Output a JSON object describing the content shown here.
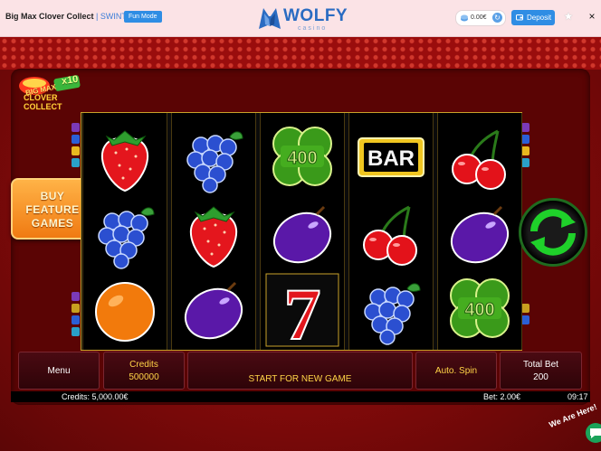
{
  "header": {
    "game_title": "Big Max Clover Collect",
    "separator": " | ",
    "provider": "SWINTT",
    "fun_mode": "Fun Mode",
    "logo_text": "WOLFY",
    "logo_sub": "casino",
    "balance": "0.00€",
    "deposit_label": "Deposit",
    "star_glyph": "★",
    "close_glyph": "×"
  },
  "game": {
    "brand_line1": "BIG MAX",
    "brand_line2": "CLOVER",
    "brand_line3": "COLLECT",
    "brand_multiplier": "x10",
    "buy_line1": "BUY",
    "buy_line2": "FEATURE",
    "buy_line3": "GAMES",
    "reels": [
      [
        "strawberry",
        "grapes",
        "orange"
      ],
      [
        "grapes",
        "strawberry",
        "plum"
      ],
      [
        "clover-400",
        "plum",
        "seven"
      ],
      [
        "bar",
        "cherry",
        "grapes"
      ],
      [
        "cherry",
        "plum",
        "clover-400"
      ]
    ],
    "clover_value": "400",
    "bar_label": "BAR",
    "seven_label": "7"
  },
  "controls": {
    "menu": "Menu",
    "credits_label": "Credits",
    "credits_value": "500000",
    "start_label": "START FOR NEW GAME",
    "auto_spin": "Auto. Spin",
    "total_bet_label": "Total Bet",
    "total_bet_value": "200"
  },
  "status": {
    "credits": "Credits: 5,000.00€",
    "bet": "Bet: 2.00€",
    "clock": "09:17"
  },
  "chat": {
    "label": "We Are Here!"
  },
  "colors": {
    "accent_blue": "#2f8de4",
    "reel_gold": "#c9a22a",
    "control_text": "#ffd447",
    "spin_green": "#1fd12a"
  }
}
